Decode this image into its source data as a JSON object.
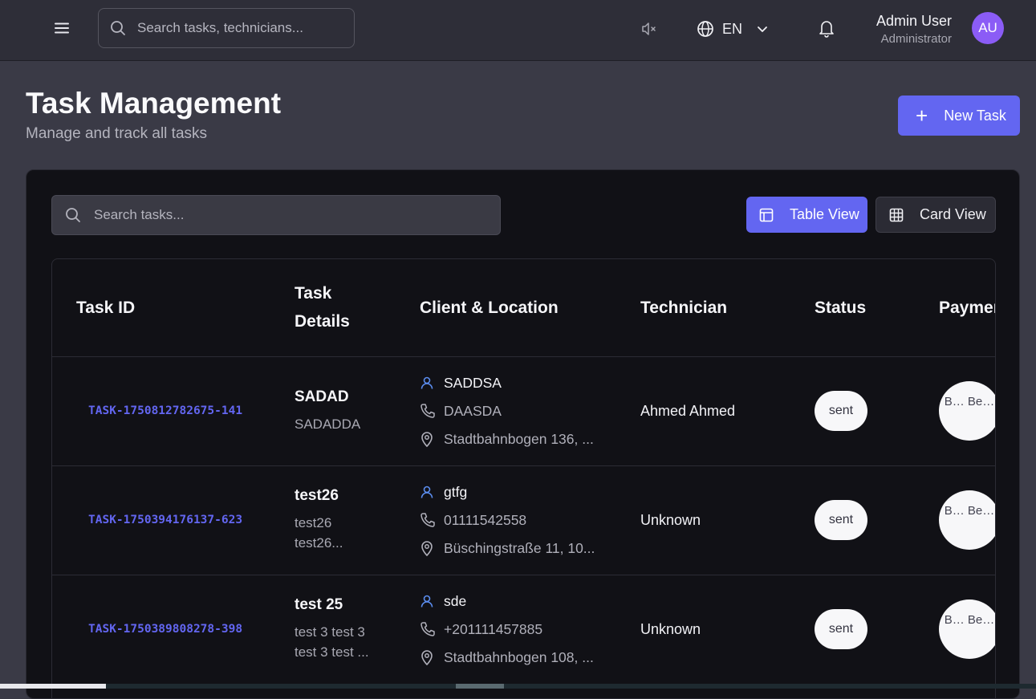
{
  "header": {
    "search_placeholder": "Search tasks, technicians...",
    "language": "EN",
    "user_name": "Admin User",
    "user_role": "Administrator",
    "avatar_initials": "AU"
  },
  "page": {
    "title": "Task Management",
    "subtitle": "Manage and track all tasks",
    "new_task_label": "New Task"
  },
  "panel": {
    "search_placeholder": "Search tasks...",
    "table_view_label": "Table View",
    "card_view_label": "Card View"
  },
  "table": {
    "columns": [
      "Task ID",
      "Task Details",
      "Client & Location",
      "Technician",
      "Status",
      "Payment"
    ],
    "rows": [
      {
        "task_id": "TASK-1750812782675-141",
        "title": "SADAD",
        "description": "SADADDA",
        "client_name": "SADDSA",
        "client_phone": "DAASDA",
        "client_location": "Stadtbahnbogen 136, ...",
        "technician": "Ahmed Ahmed",
        "status": "sent",
        "payment": "B… Be…"
      },
      {
        "task_id": "TASK-1750394176137-623",
        "title": "test26",
        "description": "test26 test26...",
        "client_name": "gtfg",
        "client_phone": "01111542558",
        "client_location": "Büschingstraße 11, 10...",
        "technician": "Unknown",
        "status": "sent",
        "payment": "B… Be…"
      },
      {
        "task_id": "TASK-1750389808278-398",
        "title": "test 25",
        "description": "test 3 test 3 test 3 test ...",
        "client_name": "sde",
        "client_phone": "+201111457885",
        "client_location": "Stadtbahnbogen 108, ...",
        "technician": "Unknown",
        "status": "sent",
        "payment": "B… Be…"
      }
    ]
  },
  "colors": {
    "accent": "#6366f1",
    "avatar": "#8b5cf6",
    "background": "#3a3a46",
    "panel": "#111116",
    "client_icon": "#5b8def"
  },
  "icons": {
    "menu": "menu-icon",
    "search": "search-icon",
    "mute": "volume-mute-icon",
    "language": "globe-icon",
    "dropdown": "chevron-down-icon",
    "notifications": "bell-icon",
    "add": "plus-icon",
    "table_view": "table-icon",
    "card_view": "grid-icon",
    "client": "user-icon",
    "phone": "phone-icon",
    "location": "map-pin-icon"
  }
}
